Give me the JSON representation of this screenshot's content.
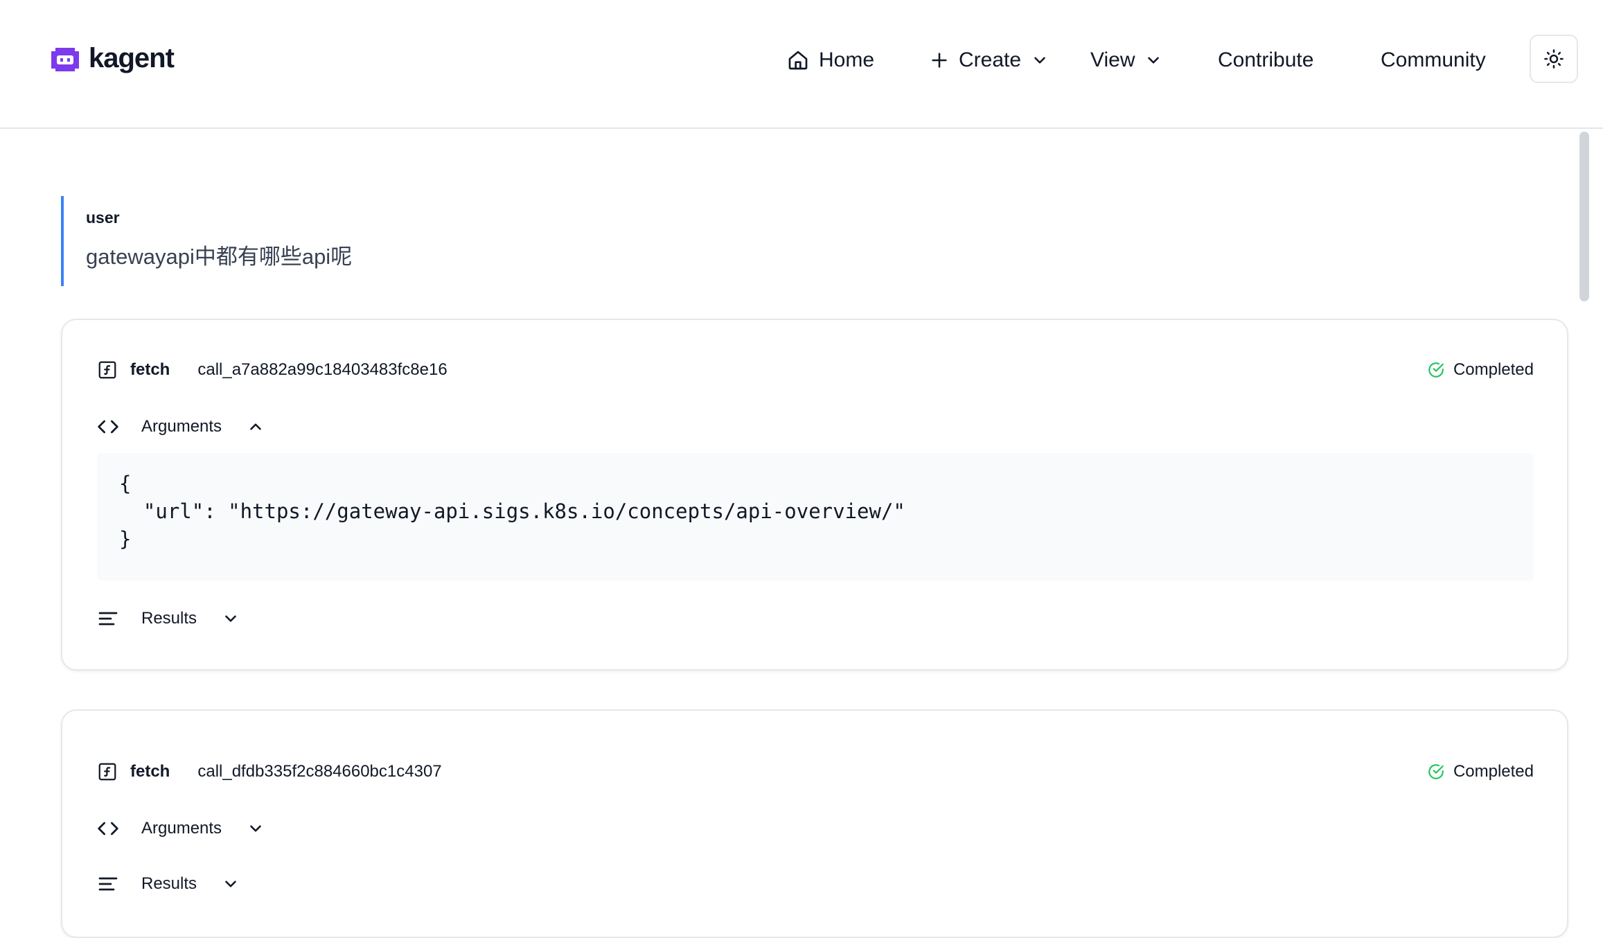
{
  "header": {
    "brand": "kagent",
    "nav": {
      "home": "Home",
      "create": "Create",
      "view": "View",
      "contribute": "Contribute",
      "community": "Community"
    },
    "icons": [
      "home-icon",
      "plus-icon",
      "chevron-down-icon",
      "sun-icon"
    ]
  },
  "conversation": {
    "user_message": {
      "role": "user",
      "text": "gatewayapi中都有哪些api呢"
    },
    "tool_calls": [
      {
        "name": "fetch",
        "call_id": "call_a7a882a99c18403483fc8e16",
        "status": "Completed",
        "arguments_label": "Arguments",
        "arguments_expanded": true,
        "arguments_code": "{\n  \"url\": \"https://gateway-api.sigs.k8s.io/concepts/api-overview/\"\n}",
        "results_label": "Results",
        "results_expanded": false
      },
      {
        "name": "fetch",
        "call_id": "call_dfdb335f2c884660bc1c4307",
        "status": "Completed",
        "arguments_label": "Arguments",
        "arguments_expanded": false,
        "results_label": "Results",
        "results_expanded": false
      }
    ]
  },
  "colors": {
    "brand_purple": "#7c3aed",
    "user_accent": "#3b82f6",
    "status_green": "#22c55e",
    "border": "#e5e7eb",
    "code_bg": "#f9fafb"
  }
}
